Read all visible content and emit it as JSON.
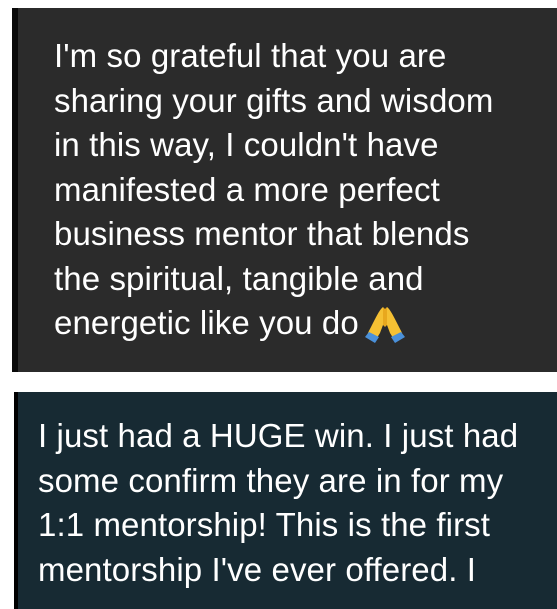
{
  "messages": [
    {
      "lines": [
        "I'm so grateful that you are",
        "sharing your gifts and wisdom",
        "in this way, I couldn't have",
        "manifested a more perfect",
        "business mentor that blends",
        "the spiritual, tangible and",
        "energetic like you do"
      ],
      "emoji": "folded-hands-icon"
    },
    {
      "lines": [
        "I just had a HUGE win. I just had",
        "some confirm they are in for my",
        "1:1 mentorship! This is the first",
        "mentorship I've ever offered. I"
      ]
    }
  ]
}
